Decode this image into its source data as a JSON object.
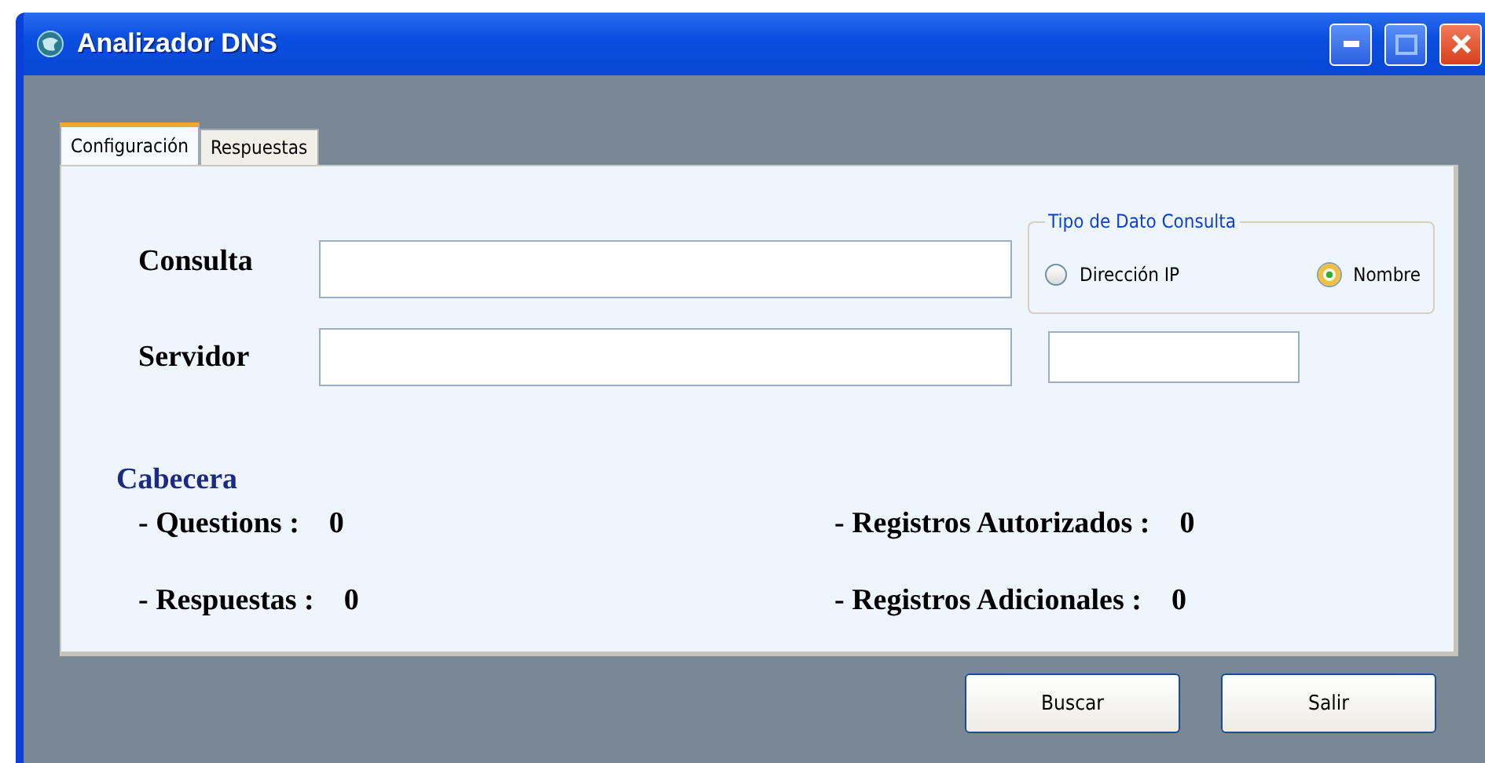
{
  "window": {
    "title": "Analizador DNS"
  },
  "tabs": [
    {
      "label": "Configuración",
      "selected": true
    },
    {
      "label": "Respuestas",
      "selected": false
    }
  ],
  "form": {
    "query_label": "Consulta",
    "server_label": "Servidor"
  },
  "query_type": {
    "title": "Tipo de Dato Consulta",
    "options": [
      {
        "label": "Dirección IP",
        "selected": false
      },
      {
        "label": "Nombre",
        "selected": true
      }
    ]
  },
  "header": {
    "title": "Cabecera",
    "stats": [
      {
        "label": "- Questions :",
        "value": "0"
      },
      {
        "label": "- Registros Autorizados :",
        "value": "0"
      },
      {
        "label": "- Respuestas :",
        "value": "0"
      },
      {
        "label": "- Registros Adicionales :",
        "value": "0"
      }
    ]
  },
  "buttons": [
    "Buscar",
    "Salir"
  ]
}
